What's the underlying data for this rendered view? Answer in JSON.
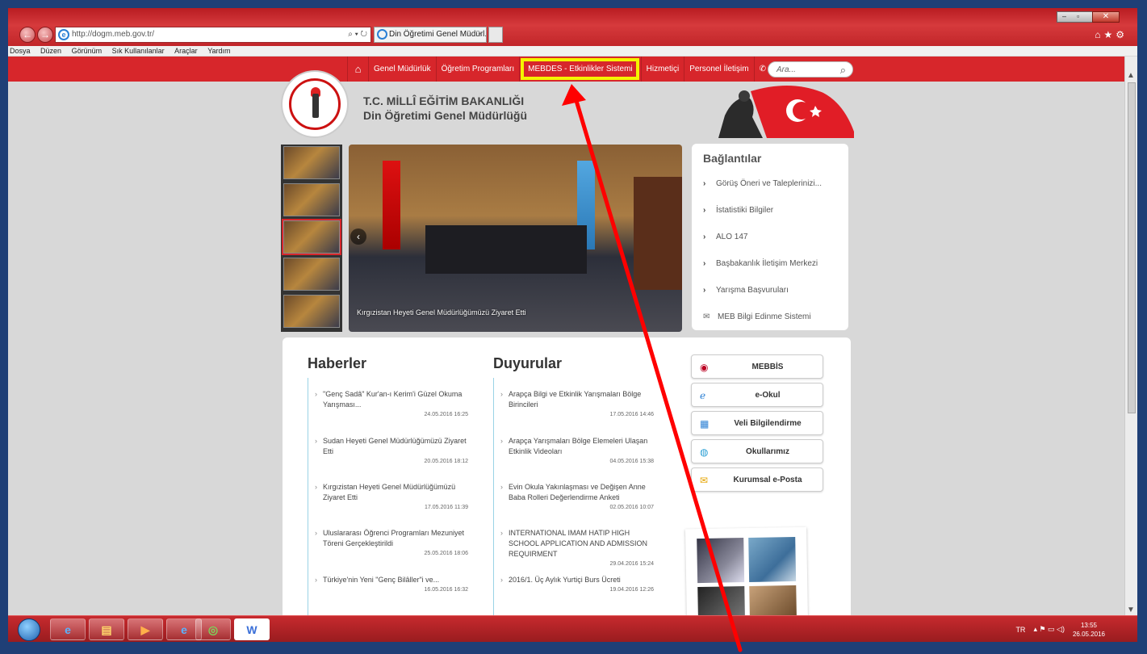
{
  "browser": {
    "url": "http://dogm.meb.gov.tr/",
    "tab_title": "Din Öğretimi Genel Müdürl...",
    "addr_tools": "⌕ ▾ ↻",
    "tab_close": "×",
    "menu": [
      "Dosya",
      "Düzen",
      "Görünüm",
      "Sık Kullanılanlar",
      "Araçlar",
      "Yardım"
    ]
  },
  "site_nav": {
    "items": [
      "Genel Müdürlük",
      "Öğretim Programları",
      "MEBDES - Etkinlikler Sistemi",
      "Hizmetiçi",
      "Personel İletişim"
    ],
    "search_placeholder": "Ara..."
  },
  "brand": {
    "line1": "T.C. MİLLÎ EĞİTİM BAKANLIĞI",
    "line2": "Din Öğretimi Genel Müdürlüğü"
  },
  "slider": {
    "caption": "Kırgızistan Heyeti Genel Müdürlüğümüzü Ziyaret Etti"
  },
  "links": {
    "title": "Bağlantılar",
    "items": [
      "Görüş Öneri ve Taleplerinizi...",
      "İstatistiki Bilgiler",
      "ALO 147",
      "Başbakanlık İletişim Merkezi",
      "Yarışma Başvuruları",
      "MEB Bilgi Edinme Sistemi"
    ]
  },
  "haberler": {
    "title": "Haberler",
    "items": [
      {
        "title": "\"Genç Sadâ\" Kur'an-ı Kerim'i Güzel Okuma Yarışması...",
        "date": "24.05.2016 16:25"
      },
      {
        "title": "Sudan Heyeti Genel Müdürlüğümüzü Ziyaret Etti",
        "date": "20.05.2016 18:12"
      },
      {
        "title": "Kırgızistan Heyeti Genel Müdürlüğümüzü Ziyaret Etti",
        "date": "17.05.2016 11:39"
      },
      {
        "title": "Uluslararası Öğrenci Programları Mezuniyet Töreni Gerçekleştirildi",
        "date": "25.05.2016 18:06"
      },
      {
        "title": "Türkiye'nin Yeni \"Genç Bilâller\"i ve...",
        "date": "16.05.2016 16:32"
      }
    ]
  },
  "duyurular": {
    "title": "Duyurular",
    "items": [
      {
        "title": "Arapça Bilgi ve Etkinlik Yarışmaları Bölge Birincileri",
        "date": "17.05.2016 14:46"
      },
      {
        "title": "Arapça Yarışmaları Bölge Elemeleri Ulaşan Etkinlik Videoları",
        "date": "04.05.2016 15:38"
      },
      {
        "title": "Evin Okula Yakınlaşması ve Değişen Anne Baba Rolleri Değerlendirme Anketi",
        "date": "02.05.2016 10:07"
      },
      {
        "title": "INTERNATIONAL IMAM HATIP HIGH SCHOOL APPLICATION AND ADMISSION REQUIRMENT",
        "date": "29.04.2016 15:24"
      },
      {
        "title": "2016/1. Üç Aylık Yurtiçi Burs Ücreti",
        "date": "19.04.2016 12:26"
      }
    ]
  },
  "systems": [
    "MEBBİS",
    "e-Okul",
    "Veli Bilgilendirme",
    "Okullarımız",
    "Kurumsal e-Posta"
  ],
  "taskbar": {
    "lang": "TR",
    "time": "13:55",
    "date": "26.05.2016"
  },
  "colors": {
    "brand_red": "#d7262b",
    "highlight_yellow": "#f4f400",
    "arrow_red": "#ff0000"
  }
}
